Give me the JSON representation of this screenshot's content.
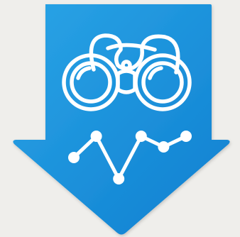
{
  "icon": {
    "name": "download-insights-icon",
    "background_color": "#efeeeb",
    "arrow_color_light": "#2aa4e6",
    "arrow_color_dark": "#0f7fd0",
    "line_color": "#ffffff",
    "parts": [
      "down-arrow-icon",
      "binoculars-icon",
      "trend-line-icon"
    ],
    "trend": {
      "points": [
        {
          "x": 1,
          "y": 2
        },
        {
          "x": 2,
          "y": 3
        },
        {
          "x": 3,
          "y": 1
        },
        {
          "x": 4,
          "y": 3
        },
        {
          "x": 5,
          "y": 2.5
        },
        {
          "x": 6,
          "y": 3
        }
      ]
    }
  }
}
